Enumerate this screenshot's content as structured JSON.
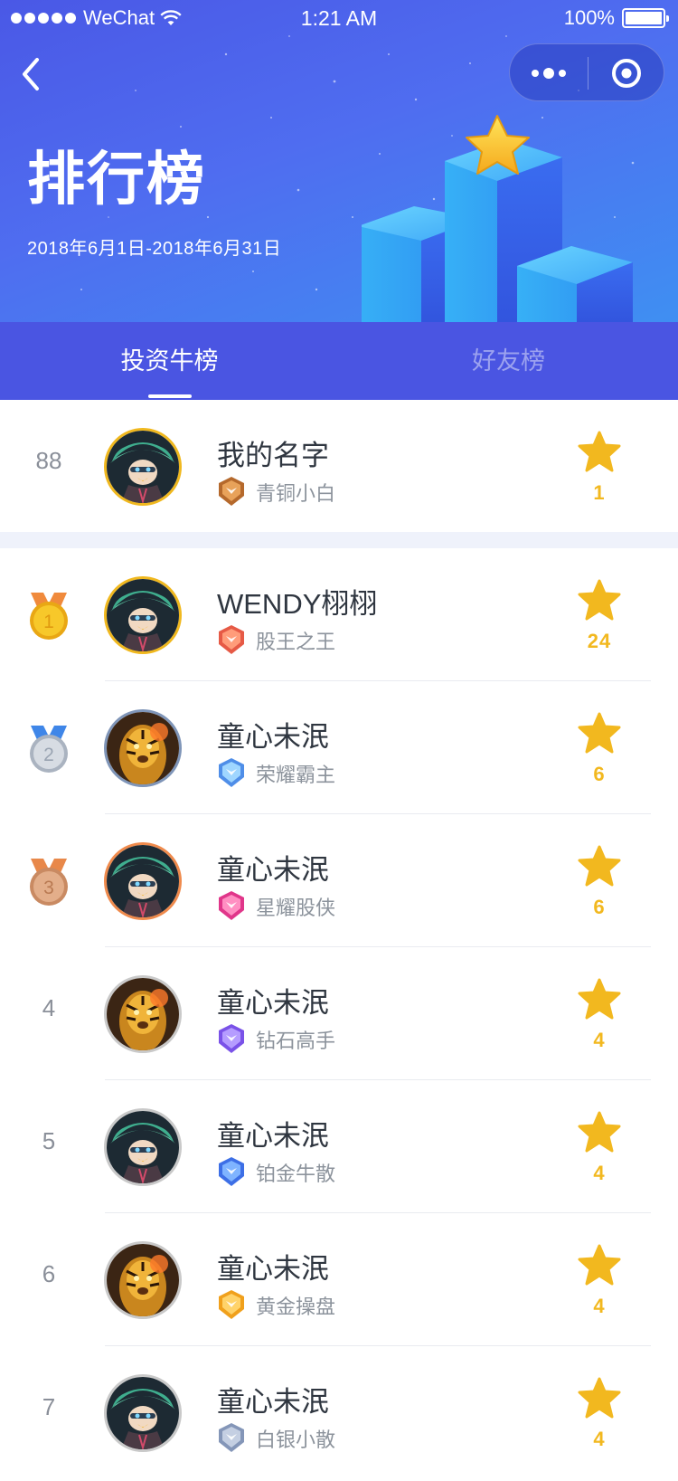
{
  "status_bar": {
    "carrier": "WeChat",
    "time": "1:21 AM",
    "battery": "100%"
  },
  "header": {
    "title": "排行榜",
    "date_range": "2018年6月1日-2018年6月31日"
  },
  "tabs": [
    {
      "label": "投资牛榜",
      "active": true
    },
    {
      "label": "好友榜",
      "active": false
    }
  ],
  "my_rank": {
    "rank": "88",
    "name": "我的名字",
    "title": "青铜小白",
    "stars": "1",
    "avatar": "green-hair-avatar",
    "badge": "bronze-rank-badge"
  },
  "ranking": [
    {
      "rank": "1",
      "name": "WENDY栩栩",
      "title": "股王之王",
      "stars": "24",
      "avatar": "green-hair-avatar",
      "badge": "king-rank-badge",
      "medal": "gold"
    },
    {
      "rank": "2",
      "name": "童心未泯",
      "title": "荣耀霸主",
      "stars": "6",
      "avatar": "tiger-avatar",
      "badge": "glory-rank-badge",
      "medal": "silver"
    },
    {
      "rank": "3",
      "name": "童心未泯",
      "title": "星耀股侠",
      "stars": "6",
      "avatar": "green-hair-avatar",
      "badge": "star-rank-badge",
      "medal": "bronze"
    },
    {
      "rank": "4",
      "name": "童心未泯",
      "title": "钻石高手",
      "stars": "4",
      "avatar": "tiger-avatar",
      "badge": "diamond-rank-badge",
      "medal": ""
    },
    {
      "rank": "5",
      "name": "童心未泯",
      "title": "铂金牛散",
      "stars": "4",
      "avatar": "green-hair-avatar",
      "badge": "platinum-rank-badge",
      "medal": ""
    },
    {
      "rank": "6",
      "name": "童心未泯",
      "title": "黄金操盘",
      "stars": "4",
      "avatar": "tiger-avatar",
      "badge": "gold-rank-badge",
      "medal": ""
    },
    {
      "rank": "7",
      "name": "童心未泯",
      "title": "白银小散",
      "stars": "4",
      "avatar": "green-hair-avatar",
      "badge": "silver-rank-badge",
      "medal": ""
    }
  ],
  "colors": {
    "header_gradient": [
      "#4a58e6",
      "#3f8ff2"
    ],
    "tab_bar": "#4a55e2",
    "star": "#f2b81f",
    "gold_medal": "#f5c21b",
    "silver_medal": "#c9cfd8",
    "bronze_medal": "#dca27c"
  }
}
